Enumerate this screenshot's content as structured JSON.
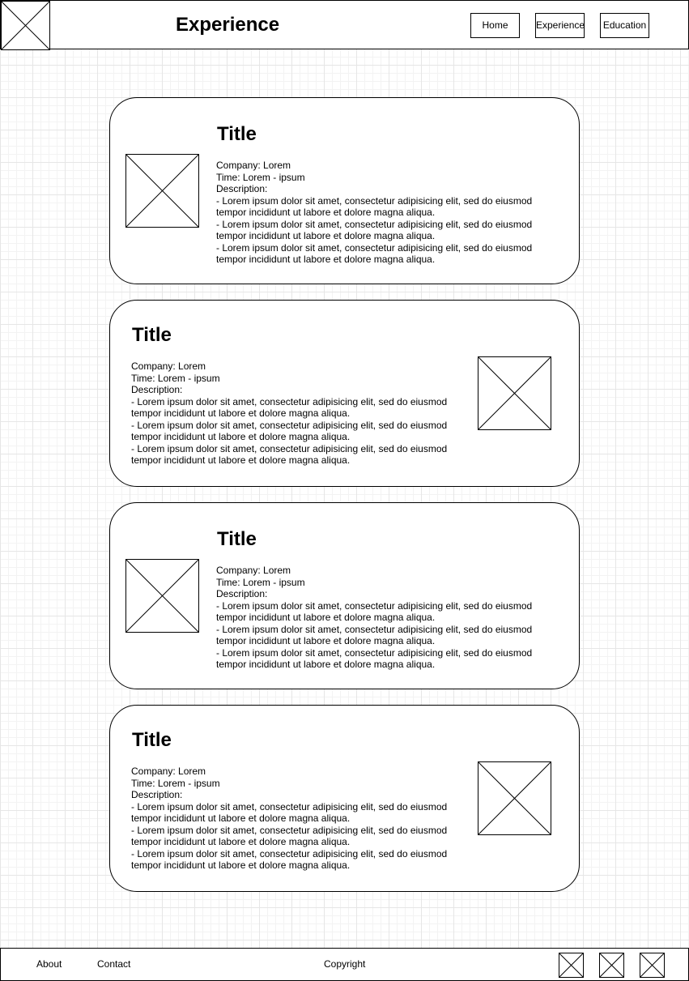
{
  "header": {
    "title": "Experience",
    "nav": [
      "Home",
      "Experience",
      "Education"
    ]
  },
  "cards": [
    {
      "title": "Title",
      "company": "Company: Lorem",
      "time": "Time: Lorem - ipsum",
      "description_label": "Description:",
      "items": [
        "- Lorem ipsum dolor sit amet, consectetur adipisicing elit, sed do eiusmod tempor incididunt ut labore et dolore magna aliqua.",
        "- Lorem ipsum dolor sit amet, consectetur adipisicing elit, sed do eiusmod tempor incididunt ut labore et dolore magna aliqua.",
        "- Lorem ipsum dolor sit amet, consectetur adipisicing elit, sed do eiusmod tempor incididunt ut labore et dolore magna aliqua."
      ]
    },
    {
      "title": "Title",
      "company": "Company: Lorem",
      "time": "Time: Lorem - ipsum",
      "description_label": "Description:",
      "items": [
        "- Lorem ipsum dolor sit amet, consectetur adipisicing elit, sed do eiusmod tempor incididunt ut labore et dolore magna aliqua.",
        "- Lorem ipsum dolor sit amet, consectetur adipisicing elit, sed do eiusmod tempor incididunt ut labore et dolore magna aliqua.",
        "- Lorem ipsum dolor sit amet, consectetur adipisicing elit, sed do eiusmod tempor incididunt ut labore et dolore magna aliqua."
      ]
    },
    {
      "title": "Title",
      "company": "Company: Lorem",
      "time": "Time: Lorem - ipsum",
      "description_label": "Description:",
      "items": [
        "- Lorem ipsum dolor sit amet, consectetur adipisicing elit, sed do eiusmod tempor incididunt ut labore et dolore magna aliqua.",
        "- Lorem ipsum dolor sit amet, consectetur adipisicing elit, sed do eiusmod tempor incididunt ut labore et dolore magna aliqua.",
        "- Lorem ipsum dolor sit amet, consectetur adipisicing elit, sed do eiusmod tempor incididunt ut labore et dolore magna aliqua."
      ]
    },
    {
      "title": "Title",
      "company": "Company: Lorem",
      "time": "Time: Lorem - ipsum",
      "description_label": "Description:",
      "items": [
        "- Lorem ipsum dolor sit amet, consectetur adipisicing elit, sed do eiusmod tempor incididunt ut labore et dolore magna aliqua.",
        "- Lorem ipsum dolor sit amet, consectetur adipisicing elit, sed do eiusmod tempor incididunt ut labore et dolore magna aliqua.",
        "- Lorem ipsum dolor sit amet, consectetur adipisicing elit, sed do eiusmod tempor incididunt ut labore et dolore magna aliqua."
      ]
    }
  ],
  "footer": {
    "links": [
      "About",
      "Contact"
    ],
    "copyright": "Copyright",
    "social_icons": [
      "image-placeholder-icon",
      "image-placeholder-icon",
      "image-placeholder-icon"
    ]
  }
}
